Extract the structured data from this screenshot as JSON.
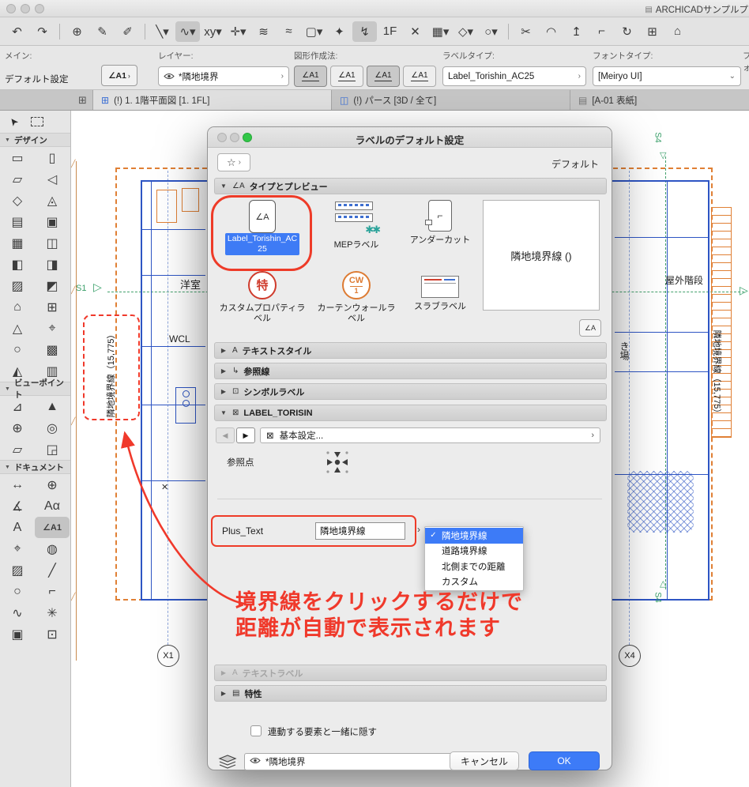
{
  "titlebar": {
    "app_title": "ARCHICADサンプルプ"
  },
  "glyphs": {
    "star": "☆",
    "chev": "›",
    "popup": "⌄",
    "tri_open": "▼",
    "tri_closed": "▶",
    "back": "◀",
    "fwd": "▶",
    "check": "✓",
    "quick_grid": "⊞",
    "pointer": "➤",
    "app_icon": "▤",
    "sec_type_icon": "∠A",
    "sec_text_icon": "A",
    "sec_ref_icon": "↳",
    "sec_sym_icon": "⊡",
    "sec_tor_icon": "⊠",
    "sec_tlabel_icon": "A",
    "sec_prop_icon": "▤",
    "tool_chip": "∠A1",
    "doc1_glyph": "∠A",
    "doc2_glyph": "⌐",
    "gears": "✱✱",
    "preview_btn_glyph": "∠A",
    "xmark": "✕"
  },
  "toolbar": {
    "icons": [
      {
        "g": "↶",
        "n": "undo-icon"
      },
      {
        "g": "↷",
        "n": "redo-icon"
      },
      {
        "g": "",
        "n": "separator",
        "cls": "sep"
      },
      {
        "g": "⊕",
        "n": "zoom-icon"
      },
      {
        "g": "✎",
        "n": "pickup-parameters-icon"
      },
      {
        "g": "✐",
        "n": "inject-parameters-icon"
      },
      {
        "g": "",
        "n": "separator",
        "cls": "sep"
      },
      {
        "g": "╲▾",
        "n": "arrow-segment-icon"
      },
      {
        "g": "∿▾",
        "n": "curve-mode-icon",
        "cls": "sel"
      },
      {
        "g": "xy▾",
        "n": "coordinate-input-icon"
      },
      {
        "g": "✛▾",
        "n": "snap-grid-icon"
      },
      {
        "g": "≋",
        "n": "guide-lines-icon"
      },
      {
        "g": "≈",
        "n": "snap-reference-icon"
      },
      {
        "g": "▢▾",
        "n": "marquee-options-icon"
      },
      {
        "g": "✦",
        "n": "snap-points-icon"
      },
      {
        "g": "↯",
        "n": "magic-wand-icon",
        "cls": "sel"
      },
      {
        "g": "1F",
        "n": "story-icon"
      },
      {
        "g": "✕",
        "n": "close-view-icon"
      },
      {
        "g": "▦▾",
        "n": "grid-options-icon"
      },
      {
        "g": "◇▾",
        "n": "favorites-icon"
      },
      {
        "g": "○▾",
        "n": "shapes-icon"
      },
      {
        "g": "",
        "n": "separator",
        "cls": "sep"
      },
      {
        "g": "✂",
        "n": "split-icon"
      },
      {
        "g": "◠",
        "n": "fillet-icon"
      },
      {
        "g": "↥",
        "n": "adjust-icon"
      },
      {
        "g": "⌐",
        "n": "intersect-icon"
      },
      {
        "g": "↻",
        "n": "rotate-icon"
      },
      {
        "g": "⊞",
        "n": "resize-icon"
      },
      {
        "g": "⌂",
        "n": "home-icon"
      }
    ]
  },
  "infobar": {
    "main_label": "メイン:",
    "main_value": "デフォルト設定",
    "layer_label": "レイヤー:",
    "layer_value": "*隣地境界",
    "geometry_label": "図形作成法:",
    "geometry_options": [
      {
        "t": "∠A1",
        "cls": "sel"
      },
      {
        "t": "∠A1"
      },
      {
        "t": "∠A1",
        "cls": "sel"
      },
      {
        "t": "∠A1"
      }
    ],
    "labeltype_label": "ラベルタイプ:",
    "labeltype_value": "Label_Torishin_AC25",
    "fonttype_label": "フォントタイプ:",
    "fonttype_value": "[Meiryo UI]",
    "clipped_label": "フォ"
  },
  "tabbar": {
    "tabs": [
      {
        "label": "(!) 1. 1階平面図 [1. 1FL]",
        "icon": "⊞",
        "cls": "active"
      },
      {
        "label": "(!) パース [3D / 全て]",
        "icon": "◫"
      },
      {
        "label": "[A-01 表紙]",
        "icon": "▤",
        "cls": "sheet"
      }
    ]
  },
  "sidebar": {
    "sections": [
      {
        "label": "デザイン",
        "icons": [
          {
            "g": "▭",
            "n": "wall-tool-icon"
          },
          {
            "g": "▯",
            "n": "door-tool-icon"
          },
          {
            "g": "▱",
            "n": "slab-tool-icon"
          },
          {
            "g": "◁",
            "n": "roof-tool-icon"
          },
          {
            "g": "◇",
            "n": "window-tool-icon"
          },
          {
            "g": "◬",
            "n": "mesh-tool-icon"
          },
          {
            "g": "▤",
            "n": "beam-tool-icon"
          },
          {
            "g": "▣",
            "n": "column-tool-icon"
          },
          {
            "g": "▦",
            "n": "curtainwall-tool-icon"
          },
          {
            "g": "◫",
            "n": "object-tool-icon"
          },
          {
            "g": "◧",
            "n": "zone-tool-icon"
          },
          {
            "g": "◨",
            "n": "stair-tool-icon"
          },
          {
            "g": "▨",
            "n": "railing-tool-icon"
          },
          {
            "g": "◩",
            "n": "shell-tool-icon"
          },
          {
            "g": "⌂",
            "n": "morph-tool-icon"
          },
          {
            "g": "⊞",
            "n": "skylight-tool-icon"
          },
          {
            "g": "△",
            "n": "lamp-tool-icon"
          },
          {
            "g": "⌖",
            "n": "grid-element-tool-icon"
          },
          {
            "g": "○",
            "n": "opening-tool-icon"
          },
          {
            "g": "▩",
            "n": "hotlink-tool-icon"
          },
          {
            "g": "◭",
            "n": "figure-tool-icon"
          },
          {
            "g": "▥",
            "n": "surface-tool-icon"
          }
        ]
      },
      {
        "label": "ビューポイント",
        "icons": [
          {
            "g": "⊿",
            "n": "section-tool-icon"
          },
          {
            "g": "▲",
            "n": "elevation-tool-icon"
          },
          {
            "g": "⊕",
            "n": "interior-elevation-tool-icon"
          },
          {
            "g": "◎",
            "n": "camera-tool-icon"
          },
          {
            "g": "▱",
            "n": "worksheet-tool-icon"
          },
          {
            "g": "◲",
            "n": "detail-tool-icon"
          }
        ]
      },
      {
        "label": "ドキュメント",
        "icons": [
          {
            "g": "↔",
            "n": "linear-dimension-tool-icon"
          },
          {
            "g": "⊕",
            "n": "level-dimension-tool-icon"
          },
          {
            "g": "∡",
            "n": "angle-dimension-tool-icon"
          },
          {
            "g": "Aα",
            "n": "text-style-tool-icon"
          },
          {
            "g": "A",
            "n": "text-tool-icon"
          },
          {
            "g": "∠A1",
            "n": "label-tool-icon",
            "cls": "sel"
          },
          {
            "g": "⌖",
            "n": "hotspot-tool-icon"
          },
          {
            "g": "◍",
            "n": "zone-stamp-tool-icon"
          },
          {
            "g": "▨",
            "n": "fill-tool-icon"
          },
          {
            "g": "╱",
            "n": "line-tool-icon"
          },
          {
            "g": "○",
            "n": "circle-tool-icon"
          },
          {
            "g": "⌐",
            "n": "polyline-tool-icon"
          },
          {
            "g": "∿",
            "n": "spline-tool-icon"
          },
          {
            "g": "✳",
            "n": "hotspot2-tool-icon"
          },
          {
            "g": "▣",
            "n": "image-tool-icon"
          },
          {
            "g": "⊡",
            "n": "drawing-tool-icon"
          }
        ]
      }
    ]
  },
  "canvas": {
    "left_boundary": "隣地境界線（15,775）",
    "right_boundary": "隣地境界線（15,775）",
    "wcl": "WCL",
    "yoshitsu": "洋室",
    "okugai": "屋外階段",
    "kiba": "き場",
    "s1": "S1",
    "s4": "S4",
    "x1": "X1",
    "x4": "X4"
  },
  "annotation": {
    "line1": "境界線をクリックするだけで",
    "line2": "距離が自動で表示されます"
  },
  "dialog": {
    "title": "ラベルのデフォルト設定",
    "default_text": "デフォルト",
    "sections": {
      "type": "タイプとプレビュー",
      "textstyle": "テキストスタイル",
      "refline": "参照線",
      "symbol": "シンボルラベル",
      "torishin": "LABEL_TORISIN",
      "textlabel": "テキストラベル",
      "props": "特性"
    },
    "type_items": [
      {
        "label": "Label_Torishin_AC25"
      },
      {
        "label": "MEPラベル"
      },
      {
        "label": "アンダーカット"
      },
      {
        "label": "カスタムプロパティラベル",
        "badge": "特"
      },
      {
        "label": "カーテンウォールラベル",
        "badge": "CW",
        "num": "1"
      },
      {
        "label": "スラブラベル"
      }
    ],
    "preview_text": "隣地境界線 ()",
    "nav_value": "基本設定...",
    "refpoint_label": "参照点",
    "plus_text_label": "Plus_Text",
    "plus_text_value": "隣地境界線",
    "dropdown": {
      "selected": "隣地境界線",
      "options": [
        {
          "label": "隣地境界線",
          "cls": "active",
          "ck": "✓"
        },
        {
          "label": "道路境界線"
        },
        {
          "label": "北側までの距離"
        },
        {
          "label": "カスタム"
        }
      ]
    },
    "hide_checkbox_label": "連動する要素と一緒に隠す",
    "footer_layer": "*隣地境界",
    "cancel_label": "キャンセル",
    "ok_label": "OK"
  }
}
